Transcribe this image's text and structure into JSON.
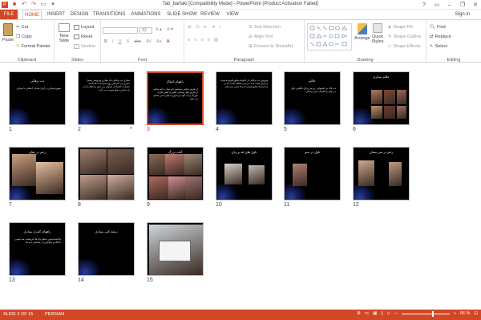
{
  "window": {
    "title": "Tab_barfaki [Compatibility Mode] - PowerPoint (Product Activation Failed)",
    "controls": [
      "?",
      "▭",
      "–",
      "❐",
      "✕"
    ]
  },
  "qat": [
    "save-icon",
    "undo-icon",
    "redo-icon",
    "present-icon",
    "customize-icon"
  ],
  "tabs": [
    "FILE",
    "HOME",
    "INSERT",
    "DESIGN",
    "TRANSITIONS",
    "ANIMATIONS",
    "SLIDE SHOW",
    "REVIEW",
    "VIEW"
  ],
  "active_tab": "HOME",
  "signin": "Sign in",
  "ribbon": {
    "clipboard": {
      "label": "Clipboard",
      "paste": "Paste",
      "cut": "Cut",
      "copy": "Copy",
      "format_painter": "Format Painter"
    },
    "slides": {
      "label": "Slides",
      "new_slide": "New Slide",
      "layout": "Layout",
      "reset": "Reset",
      "section": "Section"
    },
    "font": {
      "label": "Font",
      "size": "32",
      "buttons": [
        "B",
        "I",
        "U",
        "S",
        "abc",
        "AV",
        "Aa",
        "A"
      ]
    },
    "paragraph": {
      "label": "Paragraph",
      "text_direction": "Text Direction",
      "align_text": "Align Text",
      "convert": "Convert to SmartArt"
    },
    "drawing": {
      "label": "Drawing",
      "arrange": "Arrange",
      "quick_styles": "Quick Styles",
      "shape_fill": "Shape Fill",
      "shape_outline": "Shape Outline",
      "shape_effects": "Shape Effects"
    },
    "editing": {
      "label": "Editing",
      "find": "Find",
      "replace": "Replace",
      "select": "Select"
    }
  },
  "slides": [
    {
      "num": "1",
      "title": "تب برفکی",
      "body": "شیوع بیماری در ایران\nهدف: آشنایی با بیماری",
      "star": ""
    },
    {
      "num": "2",
      "title": "",
      "body": "بیماری تب برفکی یک بیماری ویروسی بسیار مسری در دام های زوج سم است که باعث خسارت اقتصادی فراوان می شود و انتقال آن از راه تماس و هوا صورت می گیرد",
      "star": "*"
    },
    {
      "num": "3",
      "title": "راههای انتقال",
      "body": "از طریق تماس مستقیم دام بیمار با دام سالم، از طریق هوا، وسایل، لباس و کفش افراد، خوراک و آب آلوده و فرآورده های دامی منتقل می شود",
      "star": ""
    },
    {
      "num": "4",
      "title": "",
      "body": "ویروس تب برفکی از خانواده پیکورناویریده بوده و دارای هفت تیپ سرمی مختلف است که در ایران تیپ های O و A و آسیا یک شایع هستند",
      "star": ""
    },
    {
      "num": "5",
      "title": "علائم",
      "body": "تب بالا، بی اشتهایی، ریزش بزاق، لنگش، تاول در دهان و اطراف سم و پستان",
      "star": ""
    },
    {
      "num": "6",
      "title": "علائم بیماری",
      "body": "",
      "star": ""
    },
    {
      "num": "7",
      "title": "زخم در دهان",
      "body": "",
      "star": ""
    },
    {
      "num": "8",
      "title": "",
      "body": "",
      "star": ""
    },
    {
      "num": "9",
      "title": "آفت بزرگ",
      "body": "",
      "star": ""
    },
    {
      "num": "10",
      "title": "تاول های لثه و زبان",
      "body": "",
      "star": ""
    },
    {
      "num": "11",
      "title": "تاول در سم",
      "body": "",
      "star": ""
    },
    {
      "num": "12",
      "title": "زخم در سر پستان",
      "body": "",
      "star": ""
    },
    {
      "num": "13",
      "title": "راههای کنترل بیماری",
      "body": "واکسیناسیون منظم دام ها، قرنطینه، ضدعفونی جایگاه و جلوگیری از جابجایی دام ها",
      "star": ""
    },
    {
      "num": "14",
      "title": "ریشه کنی بیماری",
      "body": "",
      "star": ""
    },
    {
      "num": "15",
      "title": "",
      "body": "",
      "star": ""
    }
  ],
  "selected_slide": "3",
  "status": {
    "slide_info": "SLIDE 3 OF 15",
    "language": "PERSIAN",
    "zoom": "66 %",
    "zoom_level": 0.66
  },
  "colors": {
    "accent": "#d24726",
    "slide_bg": "#000000",
    "slide_glow": "#2a3f9a"
  }
}
